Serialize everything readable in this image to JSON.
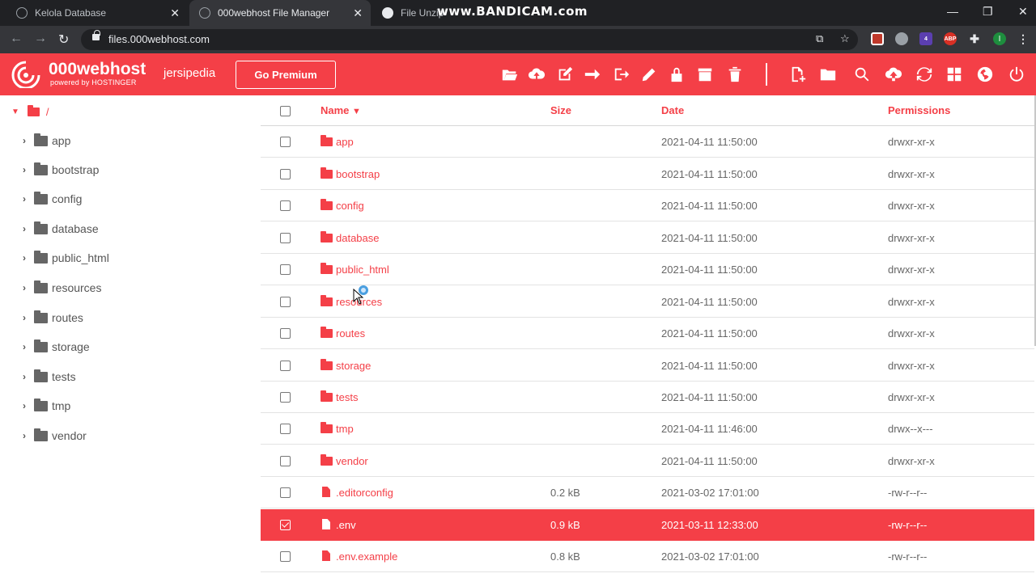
{
  "browser": {
    "tabs": [
      {
        "title": "Kelola Database",
        "active": false
      },
      {
        "title": "000webhost File Manager",
        "active": true
      },
      {
        "title": "File Unzip",
        "active": false
      }
    ],
    "watermark": "www.BANDICAM.com",
    "url": "files.000webhost.com",
    "extensions": {
      "abp": "ABP",
      "badge": "4",
      "profile": "I"
    }
  },
  "app": {
    "brand": "000webhost",
    "brand_sub": "powered by HOSTINGER",
    "username": "jersipedia",
    "premium_label": "Go Premium",
    "accent": "#f43f47"
  },
  "toolbar": {
    "icons": [
      "open-folder-icon",
      "upload-cloud-icon",
      "edit-icon",
      "move-arrow-icon",
      "exit-icon",
      "rename-pencil-icon",
      "lock-icon",
      "archive-icon",
      "trash-icon",
      "new-file-icon",
      "new-folder-icon",
      "search-icon",
      "upload-icon",
      "refresh-icon",
      "grid-view-icon",
      "globe-icon",
      "power-icon"
    ]
  },
  "tree": {
    "root": "/",
    "items": [
      "app",
      "bootstrap",
      "config",
      "database",
      "public_html",
      "resources",
      "routes",
      "storage",
      "tests",
      "tmp",
      "vendor"
    ]
  },
  "table": {
    "columns": {
      "name": "Name",
      "sort": "▼",
      "size": "Size",
      "date": "Date",
      "permissions": "Permissions"
    },
    "rows": [
      {
        "type": "folder",
        "name": "app",
        "size": "",
        "date": "2021-04-11 11:50:00",
        "perm": "drwxr-xr-x",
        "selected": false
      },
      {
        "type": "folder",
        "name": "bootstrap",
        "size": "",
        "date": "2021-04-11 11:50:00",
        "perm": "drwxr-xr-x",
        "selected": false
      },
      {
        "type": "folder",
        "name": "config",
        "size": "",
        "date": "2021-04-11 11:50:00",
        "perm": "drwxr-xr-x",
        "selected": false
      },
      {
        "type": "folder",
        "name": "database",
        "size": "",
        "date": "2021-04-11 11:50:00",
        "perm": "drwxr-xr-x",
        "selected": false
      },
      {
        "type": "folder",
        "name": "public_html",
        "size": "",
        "date": "2021-04-11 11:50:00",
        "perm": "drwxr-xr-x",
        "selected": false
      },
      {
        "type": "folder",
        "name": "resources",
        "size": "",
        "date": "2021-04-11 11:50:00",
        "perm": "drwxr-xr-x",
        "selected": false
      },
      {
        "type": "folder",
        "name": "routes",
        "size": "",
        "date": "2021-04-11 11:50:00",
        "perm": "drwxr-xr-x",
        "selected": false
      },
      {
        "type": "folder",
        "name": "storage",
        "size": "",
        "date": "2021-04-11 11:50:00",
        "perm": "drwxr-xr-x",
        "selected": false
      },
      {
        "type": "folder",
        "name": "tests",
        "size": "",
        "date": "2021-04-11 11:50:00",
        "perm": "drwxr-xr-x",
        "selected": false
      },
      {
        "type": "folder",
        "name": "tmp",
        "size": "",
        "date": "2021-04-11 11:46:00",
        "perm": "drwx--x---",
        "selected": false
      },
      {
        "type": "folder",
        "name": "vendor",
        "size": "",
        "date": "2021-04-11 11:50:00",
        "perm": "drwxr-xr-x",
        "selected": false
      },
      {
        "type": "file",
        "name": ".editorconfig",
        "size": "0.2 kB",
        "date": "2021-03-02 17:01:00",
        "perm": "-rw-r--r--",
        "selected": false
      },
      {
        "type": "file",
        "name": ".env",
        "size": "0.9 kB",
        "date": "2021-03-11 12:33:00",
        "perm": "-rw-r--r--",
        "selected": true
      },
      {
        "type": "file",
        "name": ".env.example",
        "size": "0.8 kB",
        "date": "2021-03-02 17:01:00",
        "perm": "-rw-r--r--",
        "selected": false
      }
    ]
  }
}
